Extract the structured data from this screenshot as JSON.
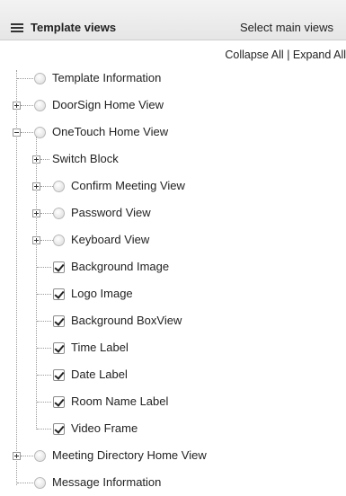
{
  "header": {
    "title": "Template views",
    "select_label": "Select main views",
    "icon": "list-icon"
  },
  "toolbar": {
    "collapse_all": "Collapse All",
    "separator": "|",
    "expand_all": "Expand All"
  },
  "tree": {
    "items": [
      {
        "label": "Template Information",
        "control": "radio",
        "checked": false,
        "expander": null
      },
      {
        "label": "DoorSign Home View",
        "control": "radio",
        "checked": false,
        "expander": "plus"
      },
      {
        "label": "OneTouch Home View",
        "control": "radio",
        "checked": false,
        "expander": "minus"
      },
      {
        "label": "Switch Block",
        "control": null,
        "checked": false,
        "expander": "plus"
      },
      {
        "label": "Confirm Meeting View",
        "control": "radio",
        "checked": false,
        "expander": "plus"
      },
      {
        "label": "Password View",
        "control": "radio",
        "checked": false,
        "expander": "plus"
      },
      {
        "label": "Keyboard View",
        "control": "radio",
        "checked": false,
        "expander": "plus"
      },
      {
        "label": "Background Image",
        "control": "checkbox",
        "checked": true,
        "expander": null
      },
      {
        "label": "Logo Image",
        "control": "checkbox",
        "checked": true,
        "expander": null
      },
      {
        "label": "Background BoxView",
        "control": "checkbox",
        "checked": true,
        "expander": null
      },
      {
        "label": "Time Label",
        "control": "checkbox",
        "checked": true,
        "expander": null
      },
      {
        "label": "Date Label",
        "control": "checkbox",
        "checked": true,
        "expander": null
      },
      {
        "label": "Room Name Label",
        "control": "checkbox",
        "checked": true,
        "expander": null
      },
      {
        "label": "Video Frame",
        "control": "checkbox",
        "checked": true,
        "expander": null
      },
      {
        "label": "Meeting Directory Home View",
        "control": "radio",
        "checked": false,
        "expander": "plus"
      },
      {
        "label": "Message Information",
        "control": "radio",
        "checked": false,
        "expander": null
      }
    ]
  }
}
